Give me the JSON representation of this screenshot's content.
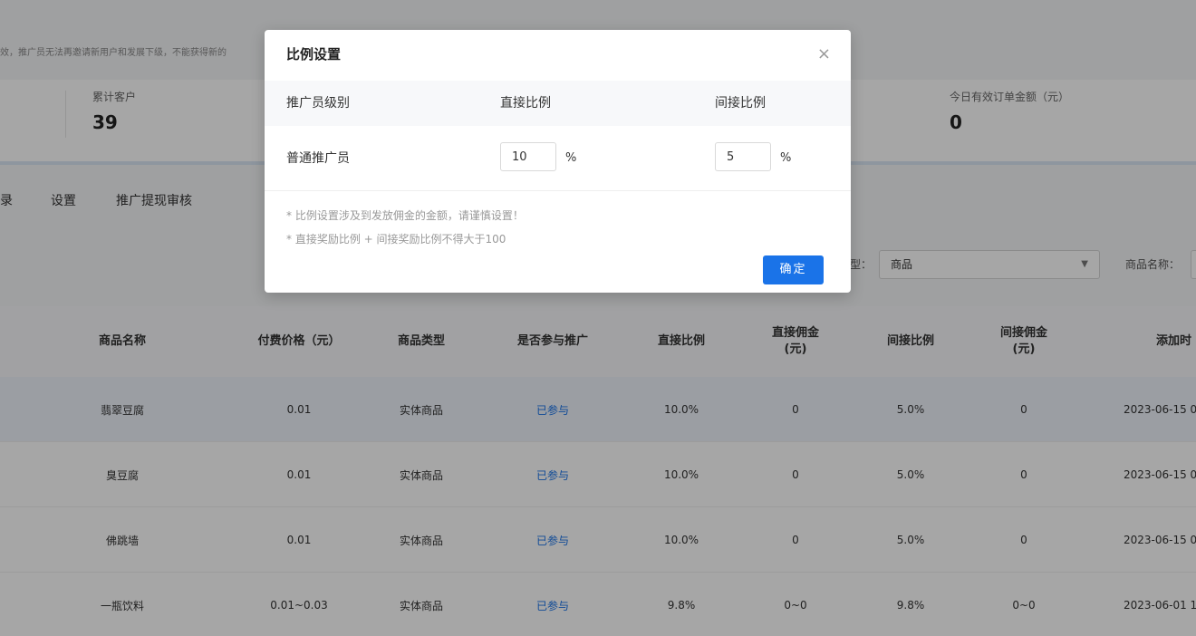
{
  "notice": "效，推广员无法再邀请新用户和发展下级，不能获得新的",
  "stats": [
    {
      "label": "累计客户",
      "value": "39"
    },
    {
      "label": "今日有效订单金额（元）",
      "value": "0"
    }
  ],
  "tabs": [
    "录",
    "设置",
    "推广提现审核"
  ],
  "filter": {
    "type_label": "型：",
    "type_value": "商品",
    "name_label": "商品名称："
  },
  "table": {
    "headers": [
      "商品名称",
      "付费价格（元）",
      "商品类型",
      "是否参与推广",
      "直接比例",
      "直接佣金\n(元)",
      "间接比例",
      "间接佣金\n(元)",
      "添加时"
    ],
    "rows": [
      [
        "翡翠豆腐",
        "0.01",
        "实体商品",
        "已参与",
        "10.0%",
        "0",
        "5.0%",
        "0",
        "2023-06-15 0"
      ],
      [
        "臭豆腐",
        "0.01",
        "实体商品",
        "已参与",
        "10.0%",
        "0",
        "5.0%",
        "0",
        "2023-06-15 0"
      ],
      [
        "佛跳墙",
        "0.01",
        "实体商品",
        "已参与",
        "10.0%",
        "0",
        "5.0%",
        "0",
        "2023-06-15 0"
      ],
      [
        "一瓶饮料",
        "0.01~0.03",
        "实体商品",
        "已参与",
        "9.8%",
        "0~0",
        "9.8%",
        "0~0",
        "2023-06-01 1"
      ]
    ]
  },
  "modal": {
    "title": "比例设置",
    "close": "×",
    "col_level": "推广员级别",
    "col_direct": "直接比例",
    "col_indirect": "间接比例",
    "level_name": "普通推广员",
    "direct_value": "10",
    "indirect_value": "5",
    "unit": "%",
    "note1": "* 比例设置涉及到发放佣金的金额，请谨慎设置！",
    "note2": "* 直接奖励比例 + 间接奖励比例不得大于100",
    "confirm": "确定"
  },
  "colors": {
    "primary": "#1a73e8",
    "overlay": "rgba(0,0,0,0.35)"
  }
}
